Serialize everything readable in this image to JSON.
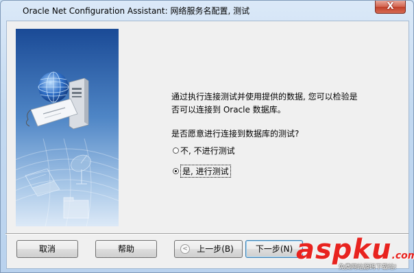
{
  "window": {
    "title": "Oracle Net Configuration Assistant: 网络服务名配置, 测试",
    "close_glyph": "X"
  },
  "wizard": {
    "description_line1": "通过执行连接测试并使用提供的数据, 您可以检验是",
    "description_line2": "否可以连接到 Oracle 数据库。",
    "question": "是否愿意进行连接到数据库的测试?",
    "options": [
      {
        "label": "不, 不进行测试",
        "checked": false
      },
      {
        "label": "是, 进行测试",
        "checked": true
      }
    ]
  },
  "buttons": {
    "cancel": "取消",
    "help": "帮助",
    "back": "上一步(B)",
    "next": "下一步(N)",
    "back_icon": "back-arrow-icon"
  },
  "watermark": {
    "logo": "aspku",
    "logo_suffix": ".com",
    "subtitle": "免费网站源码下载站!"
  },
  "colors": {
    "accent_blue": "#3c7fb1",
    "close_red": "#c0412a",
    "watermark_red": "#e8231f",
    "side_panel_top": "#1c4f9a",
    "side_panel_bottom": "#d6e6f6"
  }
}
